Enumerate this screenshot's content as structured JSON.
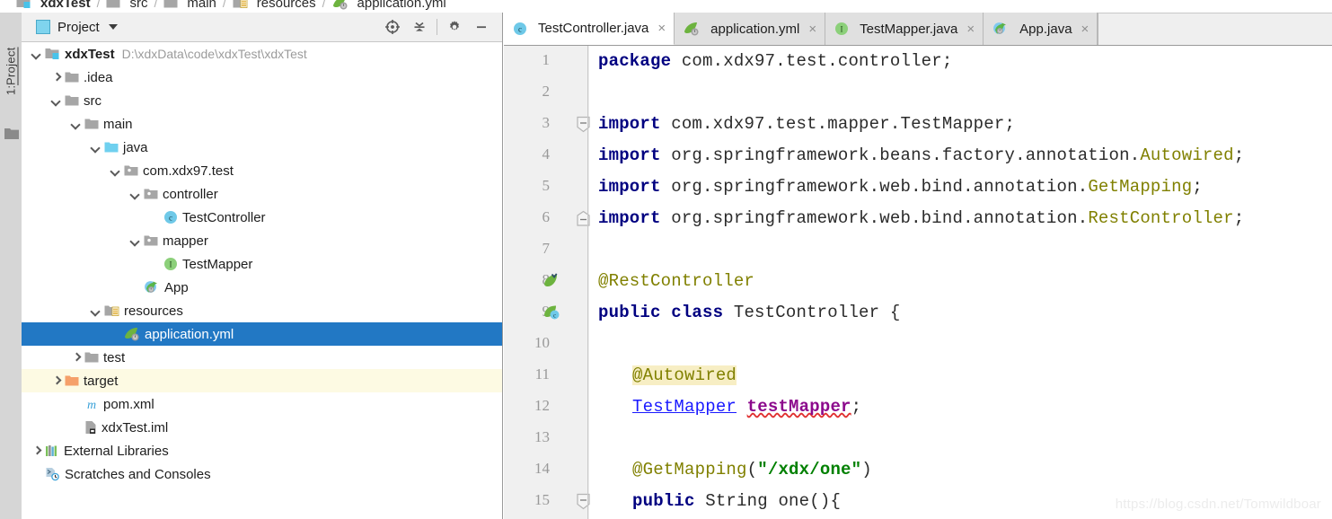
{
  "breadcrumb": {
    "items": [
      {
        "label": "xdxTest",
        "icon": "module-folder-icon",
        "root": true
      },
      {
        "label": "src",
        "icon": "folder-icon",
        "root": false
      },
      {
        "label": "main",
        "icon": "folder-icon",
        "root": false
      },
      {
        "label": "resources",
        "icon": "resources-folder-icon",
        "root": false
      },
      {
        "label": "application.yml",
        "icon": "spring-yml-icon",
        "root": false
      }
    ],
    "separator": "/"
  },
  "toolstrip": {
    "label_prefix": "1: ",
    "label": "Project",
    "folder_icon": "folder-icon"
  },
  "project_panel": {
    "title": "Project",
    "caret_icon": "chevron-down-icon",
    "tools": [
      {
        "name": "scroll-from-source-icon",
        "title": "Select Opened File"
      },
      {
        "name": "collapse-all-icon",
        "title": "Collapse All"
      },
      {
        "name": "gear-icon",
        "title": "Settings"
      },
      {
        "name": "minimize-icon",
        "title": "Hide"
      }
    ],
    "tree": [
      {
        "indent": 0,
        "arrow": "down",
        "icon": "module-folder-icon",
        "label": "xdxTest",
        "bold": true,
        "path": "D:\\xdxData\\code\\xdxTest\\xdxTest",
        "state": "normal"
      },
      {
        "indent": 1,
        "arrow": "right",
        "icon": "folder-icon",
        "label": ".idea",
        "bold": false,
        "path": "",
        "state": "normal"
      },
      {
        "indent": 1,
        "arrow": "down",
        "icon": "folder-icon",
        "label": "src",
        "bold": false,
        "path": "",
        "state": "normal"
      },
      {
        "indent": 2,
        "arrow": "down",
        "icon": "folder-icon",
        "label": "main",
        "bold": false,
        "path": "",
        "state": "normal"
      },
      {
        "indent": 3,
        "arrow": "down",
        "icon": "source-folder-icon",
        "label": "java",
        "bold": false,
        "path": "",
        "state": "normal"
      },
      {
        "indent": 4,
        "arrow": "down",
        "icon": "package-icon",
        "label": "com.xdx97.test",
        "bold": false,
        "path": "",
        "state": "normal"
      },
      {
        "indent": 5,
        "arrow": "down",
        "icon": "package-icon",
        "label": "controller",
        "bold": false,
        "path": "",
        "state": "normal"
      },
      {
        "indent": 6,
        "arrow": "none",
        "icon": "java-class-icon",
        "label": "TestController",
        "bold": false,
        "path": "",
        "state": "normal"
      },
      {
        "indent": 5,
        "arrow": "down",
        "icon": "package-icon",
        "label": "mapper",
        "bold": false,
        "path": "",
        "state": "normal"
      },
      {
        "indent": 6,
        "arrow": "none",
        "icon": "java-interface-icon",
        "label": "TestMapper",
        "bold": false,
        "path": "",
        "state": "normal"
      },
      {
        "indent": 5,
        "arrow": "none",
        "icon": "spring-boot-app-icon",
        "label": "App",
        "bold": false,
        "path": "",
        "state": "normal"
      },
      {
        "indent": 3,
        "arrow": "down",
        "icon": "resources-folder-icon",
        "label": "resources",
        "bold": false,
        "path": "",
        "state": "normal"
      },
      {
        "indent": 4,
        "arrow": "none",
        "icon": "spring-yml-icon",
        "label": "application.yml",
        "bold": false,
        "path": "",
        "state": "selected"
      },
      {
        "indent": 2,
        "arrow": "right",
        "icon": "folder-icon",
        "label": "test",
        "bold": false,
        "path": "",
        "state": "normal"
      },
      {
        "indent": 1,
        "arrow": "right",
        "icon": "excluded-folder-icon",
        "label": "target",
        "bold": false,
        "path": "",
        "state": "excluded"
      },
      {
        "indent": 2,
        "arrow": "none",
        "icon": "maven-pom-icon",
        "label": "pom.xml",
        "bold": false,
        "path": "",
        "state": "normal"
      },
      {
        "indent": 2,
        "arrow": "none",
        "icon": "iml-file-icon",
        "label": "xdxTest.iml",
        "bold": false,
        "path": "",
        "state": "normal"
      },
      {
        "indent": 0,
        "arrow": "right",
        "icon": "external-libraries-icon",
        "label": "External Libraries",
        "bold": false,
        "path": "",
        "state": "normal"
      },
      {
        "indent": 0,
        "arrow": "none",
        "icon": "scratches-icon",
        "label": "Scratches and Consoles",
        "bold": false,
        "path": "",
        "state": "normal"
      }
    ]
  },
  "editor": {
    "tabs": [
      {
        "label": "TestController.java",
        "icon": "java-class-icon",
        "active": true,
        "close": "×"
      },
      {
        "label": "application.yml",
        "icon": "spring-yml-icon",
        "active": false,
        "close": "×"
      },
      {
        "label": "TestMapper.java",
        "icon": "java-interface-icon",
        "active": false,
        "close": "×"
      },
      {
        "label": "App.java",
        "icon": "spring-boot-app-icon",
        "active": false,
        "close": "×"
      }
    ],
    "line_numbers": [
      "1",
      "2",
      "3",
      "4",
      "5",
      "6",
      "7",
      "8",
      "9",
      "10",
      "11",
      "12",
      "13",
      "14",
      "15"
    ],
    "fold_markers": [
      {
        "line": 3,
        "type": "fold-start-icon"
      },
      {
        "line": 6,
        "type": "fold-end-icon"
      },
      {
        "line": 15,
        "type": "fold-start-icon"
      }
    ],
    "gutter_icons": [
      {
        "line": 8,
        "name": "spring-bean-gutter-icon"
      },
      {
        "line": 9,
        "name": "spring-component-gutter-icon"
      }
    ],
    "code": [
      {
        "line": 1,
        "indent": 0,
        "tokens": [
          {
            "t": "package",
            "c": "kw"
          },
          {
            "t": " com.xdx97.test.controller;",
            "c": "pn"
          }
        ]
      },
      {
        "line": 2,
        "indent": 0,
        "tokens": []
      },
      {
        "line": 3,
        "indent": 0,
        "tokens": [
          {
            "t": "import",
            "c": "kw"
          },
          {
            "t": " com.xdx97.test.mapper.",
            "c": "pn"
          },
          {
            "t": "TestMapper",
            "c": "id"
          },
          {
            "t": ";",
            "c": "pn"
          }
        ]
      },
      {
        "line": 4,
        "indent": 0,
        "tokens": [
          {
            "t": "import",
            "c": "kw"
          },
          {
            "t": " org.springframework.beans.factory.annotation.",
            "c": "pn"
          },
          {
            "t": "Autowired",
            "c": "ann"
          },
          {
            "t": ";",
            "c": "pn"
          }
        ]
      },
      {
        "line": 5,
        "indent": 0,
        "tokens": [
          {
            "t": "import",
            "c": "kw"
          },
          {
            "t": " org.springframework.web.bind.annotation.",
            "c": "pn"
          },
          {
            "t": "GetMapping",
            "c": "ann"
          },
          {
            "t": ";",
            "c": "pn"
          }
        ]
      },
      {
        "line": 6,
        "indent": 0,
        "tokens": [
          {
            "t": "import",
            "c": "kw"
          },
          {
            "t": " org.springframework.web.bind.annotation.",
            "c": "pn"
          },
          {
            "t": "RestController",
            "c": "ann"
          },
          {
            "t": ";",
            "c": "pn"
          }
        ]
      },
      {
        "line": 7,
        "indent": 0,
        "tokens": []
      },
      {
        "line": 8,
        "indent": 0,
        "tokens": [
          {
            "t": "@RestController",
            "c": "ann"
          }
        ]
      },
      {
        "line": 9,
        "indent": 0,
        "tokens": [
          {
            "t": "public class",
            "c": "kw"
          },
          {
            "t": " TestController {",
            "c": "pn"
          }
        ]
      },
      {
        "line": 10,
        "indent": 0,
        "tokens": []
      },
      {
        "line": 11,
        "indent": 1,
        "tokens": [
          {
            "t": "@Autowired",
            "c": "annhl"
          }
        ]
      },
      {
        "line": 12,
        "indent": 1,
        "tokens": [
          {
            "t": "TestMapper",
            "c": "lnk"
          },
          {
            "t": " ",
            "c": "pn"
          },
          {
            "t": "testMapper",
            "c": "fld"
          },
          {
            "t": ";",
            "c": "pn"
          }
        ]
      },
      {
        "line": 13,
        "indent": 0,
        "tokens": []
      },
      {
        "line": 14,
        "indent": 1,
        "tokens": [
          {
            "t": "@GetMapping",
            "c": "ann"
          },
          {
            "t": "(",
            "c": "pn"
          },
          {
            "t": "\"/xdx/one\"",
            "c": "str"
          },
          {
            "t": ")",
            "c": "pn"
          }
        ]
      },
      {
        "line": 15,
        "indent": 1,
        "tokens": [
          {
            "t": "public",
            "c": "kw"
          },
          {
            "t": " String one(){",
            "c": "pn"
          }
        ]
      }
    ]
  },
  "watermark": "https://blog.csdn.net/Tomwildboar",
  "colors": {
    "selection_blue": "#2278c4",
    "excluded_row": "#fdfae3",
    "keyword": "#000080",
    "annotation": "#808000",
    "string": "#008000",
    "field": "#8c0a8c",
    "link": "#1a1aff",
    "gutter_bg": "#f0f0f0",
    "tabbar_bg": "#e4e4e4"
  }
}
